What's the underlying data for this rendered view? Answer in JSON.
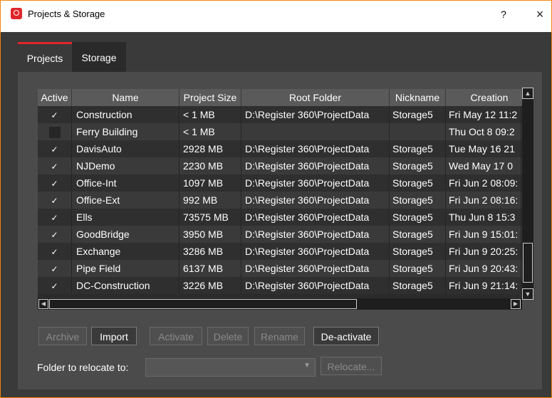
{
  "window": {
    "title": "Projects & Storage",
    "help": "?",
    "close": "×",
    "accent": "#e0262c"
  },
  "tabs": [
    {
      "label": "Projects",
      "selected": true
    },
    {
      "label": "Storage",
      "selected": false
    }
  ],
  "table": {
    "columns": [
      "Active",
      "Name",
      "Project Size",
      "Root Folder",
      "Nickname",
      "Creation"
    ],
    "rows": [
      {
        "active": true,
        "name": "Construction",
        "size": "< 1 MB",
        "root": "D:\\Register 360\\ProjectData",
        "nickname": "Storage5",
        "created": "Fri May 12 11:2"
      },
      {
        "active": false,
        "name": "Ferry Building",
        "size": "< 1 MB",
        "root": "",
        "nickname": "",
        "created": "Thu Oct 8 09:2"
      },
      {
        "active": true,
        "name": "DavisAuto",
        "size": "2928 MB",
        "root": "D:\\Register 360\\ProjectData",
        "nickname": "Storage5",
        "created": "Tue May 16 21"
      },
      {
        "active": true,
        "name": "NJDemo",
        "size": "2230 MB",
        "root": "D:\\Register 360\\ProjectData",
        "nickname": "Storage5",
        "created": "Wed May 17 0"
      },
      {
        "active": true,
        "name": "Office-Int",
        "size": "1097 MB",
        "root": "D:\\Register 360\\ProjectData",
        "nickname": "Storage5",
        "created": "Fri Jun 2 08:09:"
      },
      {
        "active": true,
        "name": "Office-Ext",
        "size": "992 MB",
        "root": "D:\\Register 360\\ProjectData",
        "nickname": "Storage5",
        "created": "Fri Jun 2 08:16:"
      },
      {
        "active": true,
        "name": "Ells",
        "size": "73575 MB",
        "root": "D:\\Register 360\\ProjectData",
        "nickname": "Storage5",
        "created": "Thu Jun 8 15:3"
      },
      {
        "active": true,
        "name": "GoodBridge",
        "size": "3950 MB",
        "root": "D:\\Register 360\\ProjectData",
        "nickname": "Storage5",
        "created": "Fri Jun 9 15:01:"
      },
      {
        "active": true,
        "name": "Exchange",
        "size": "3286 MB",
        "root": "D:\\Register 360\\ProjectData",
        "nickname": "Storage5",
        "created": "Fri Jun 9 20:25:"
      },
      {
        "active": true,
        "name": "Pipe Field",
        "size": "6137 MB",
        "root": "D:\\Register 360\\ProjectData",
        "nickname": "Storage5",
        "created": "Fri Jun 9 20:43:"
      },
      {
        "active": true,
        "name": "DC-Construction",
        "size": "3226 MB",
        "root": "D:\\Register 360\\ProjectData",
        "nickname": "Storage5",
        "created": "Fri Jun 9 21:14:"
      }
    ],
    "checkmark": "✓"
  },
  "buttons": {
    "archive": "Archive",
    "import": "Import",
    "activate": "Activate",
    "delete": "Delete",
    "rename": "Rename",
    "deactivate": "De-activate",
    "relocate": "Relocate..."
  },
  "relocate": {
    "label": "Folder to relocate to:",
    "value": ""
  }
}
